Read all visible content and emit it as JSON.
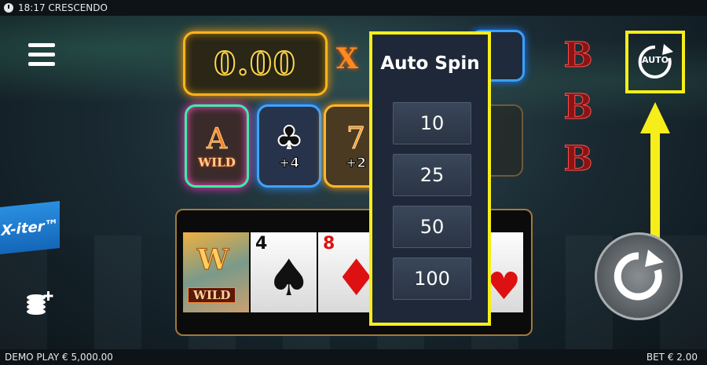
{
  "status_bar": {
    "time_title": "18:17 CRESCENDO"
  },
  "multiplier": {
    "value": "0.00",
    "x_symbol": "X"
  },
  "symbols": [
    {
      "big": "A",
      "small": "WILD"
    },
    {
      "big": "♣",
      "small": "+4"
    },
    {
      "big": "7",
      "small": "+2"
    }
  ],
  "b_column": [
    "B",
    "B",
    "B"
  ],
  "xiter_label": "X-iter™",
  "reels": [
    {
      "rank": "W",
      "label": "WILD"
    },
    {
      "rank": "4",
      "suit": "♠"
    },
    {
      "rank": "8",
      "suit": "♦"
    },
    {
      "rank": "",
      "suit": "♥"
    }
  ],
  "auto_spin": {
    "title": "Auto Spin",
    "options": [
      "10",
      "25",
      "50",
      "100"
    ]
  },
  "auto_button": {
    "label": "AUTO"
  },
  "footer": {
    "demo_play": "DEMO PLAY € 5,000.00",
    "bet": "BET € 2.00"
  },
  "colors": {
    "highlight": "#f6ee1a",
    "panel_bg": "#1e2838",
    "multiplier_border": "#ffb31a"
  }
}
